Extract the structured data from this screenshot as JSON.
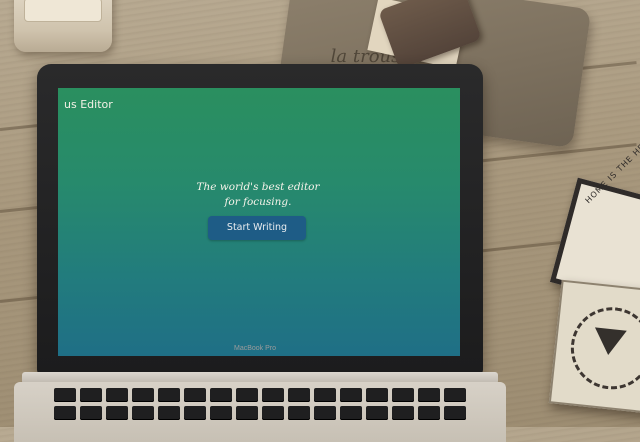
{
  "scene": {
    "props": {
      "pouch_label": "la trousse",
      "coaster_text": "HOME IS THE HEART OF THE HOLIDAYS"
    }
  },
  "laptop": {
    "model_label": "MacBook Pro",
    "screen": {
      "app_title": "us Editor",
      "tagline_line1": "The world's best editor",
      "tagline_line2": "for focusing.",
      "start_button_label": "Start Writing",
      "colors": {
        "gradient_top": "#2a8f5f",
        "gradient_bottom": "#1f6f86",
        "button": "#1e5c86",
        "text": "#f6f3ea"
      }
    }
  }
}
